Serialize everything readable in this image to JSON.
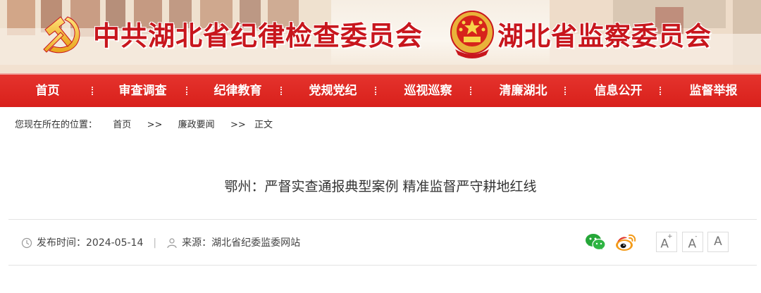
{
  "header": {
    "org_party": "中共湖北省纪律检查委员会",
    "org_state": "湖北省监察委员会"
  },
  "nav": {
    "items": [
      {
        "label": "首页"
      },
      {
        "label": "审查调查"
      },
      {
        "label": "纪律教育"
      },
      {
        "label": "党规党纪"
      },
      {
        "label": "巡视巡察"
      },
      {
        "label": "清廉湖北"
      },
      {
        "label": "信息公开"
      },
      {
        "label": "监督举报"
      }
    ]
  },
  "breadcrumb": {
    "prefix": "您现在所在的位置：",
    "home": "首页",
    "sep1": ">>",
    "section": "廉政要闻",
    "sep2": ">>",
    "current": "正文"
  },
  "article": {
    "title": "鄂州：严督实查通报典型案例 精准监督严守耕地红线",
    "published": "发布时间：2024-05-14",
    "divider": "|",
    "source": "来源：湖北省纪委监委网站"
  },
  "share": {
    "wechat_icon": "wechat-icon",
    "weibo_icon": "weibo-icon"
  },
  "font_size": {
    "larger": "A",
    "larger_mark": "+",
    "smaller": "A",
    "smaller_mark": "-",
    "reset": "A"
  },
  "colors": {
    "brand_red": "#c8161d",
    "nav_red": "#dc231e",
    "wechat_green": "#25a638",
    "weibo_orange": "#f39b1a"
  }
}
